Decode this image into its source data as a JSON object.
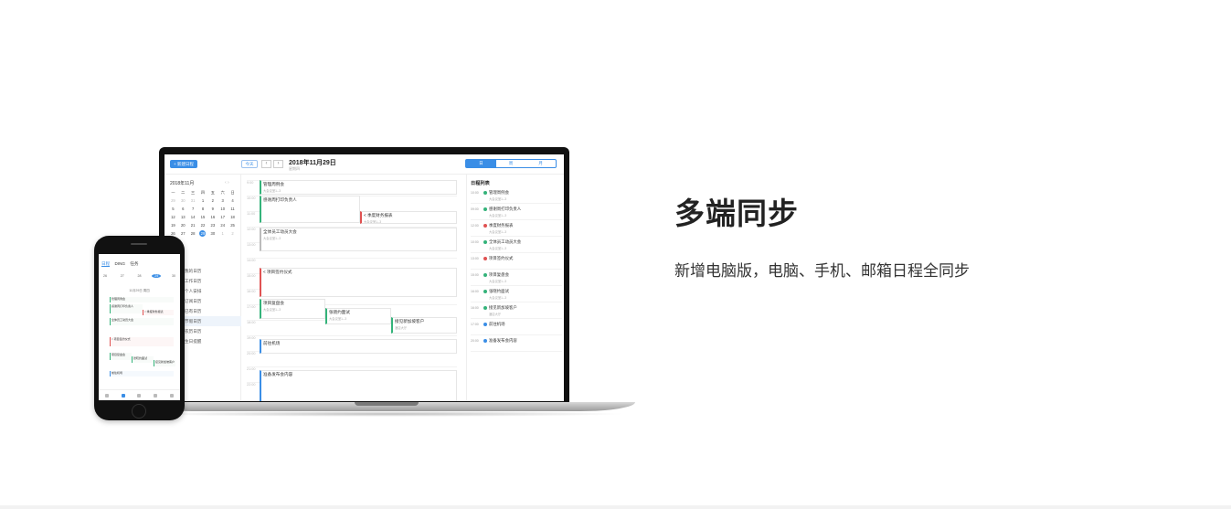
{
  "feature": {
    "title": "多端同步",
    "description": "新增电脑版，电脑、手机、邮箱日程全同步"
  },
  "desktop_app": {
    "new_button": "+ 新建日程",
    "today_button": "今天",
    "prev_icon": "chevron-left-icon",
    "next_icon": "chevron-right-icon",
    "prev_glyph": "‹",
    "next_glyph": "›",
    "date_title": "2018年11月29日",
    "date_subtitle": "星期四",
    "views": [
      "日",
      "周",
      "月"
    ],
    "mini_calendar": {
      "title": "2018年11月",
      "nav_glyphs": "‹  ›",
      "weekdays": [
        "一",
        "二",
        "三",
        "四",
        "五",
        "六",
        "日"
      ],
      "days": [
        "29",
        "30",
        "31",
        "1",
        "2",
        "3",
        "4",
        "5",
        "6",
        "7",
        "8",
        "9",
        "10",
        "11",
        "12",
        "13",
        "14",
        "15",
        "16",
        "17",
        "18",
        "19",
        "20",
        "21",
        "22",
        "23",
        "24",
        "25",
        "26",
        "27",
        "28",
        "29",
        "30",
        "1",
        "2"
      ],
      "today": "29"
    },
    "sidebar_items": [
      "我的日历",
      "工作日历",
      "个人安排",
      "订阅日历",
      "已有日历",
      "节假日历",
      "农历日历",
      "生日提醒"
    ],
    "hours": [
      "9:00",
      "10:00",
      "11:00",
      "12:00",
      "13:00",
      "14:00",
      "15:00",
      "16:00",
      "17:00",
      "18:00",
      "19:00",
      "20:00",
      "21:00",
      "22:00"
    ],
    "events": [
      {
        "title": "管理周例会",
        "sub": "大会议室1--3",
        "style": "green"
      },
      {
        "title": "感谢周打印负责人",
        "sub": "",
        "style": "green"
      },
      {
        "title": "< 季度财务报表",
        "sub": "大会议室1--3",
        "style": "red"
      },
      {
        "title": "全体员工动员大会",
        "sub": "大会议室1--3",
        "style": "gray"
      },
      {
        "title": "< 项目签约仪式",
        "sub": "",
        "style": "red"
      },
      {
        "title": "项目复盘会",
        "sub": "大会议室1--3",
        "style": "green"
      },
      {
        "title": "张晓约面试",
        "sub": "大会议室1--3",
        "style": "green"
      },
      {
        "title": "接见新加坡客户",
        "sub": "酒店大厅",
        "style": "green"
      },
      {
        "title": "前往机场",
        "sub": "",
        "style": "blue"
      },
      {
        "title": "准备发布会内容",
        "sub": "",
        "style": "blue"
      }
    ],
    "agenda": {
      "title": "日程列表",
      "items": [
        {
          "time": "10:00",
          "title": "管理周例会",
          "sub": "大会议室1--3",
          "dot": "green"
        },
        {
          "time": "09:00",
          "title": "感谢周打印负责人",
          "sub": "大会议室1--3",
          "dot": "green"
        },
        {
          "time": "12:00",
          "title": "季度财务报表",
          "sub": "大会议室1--3",
          "dot": "red"
        },
        {
          "time": "10:00",
          "title": "全体员工动员大会",
          "sub": "大会议室1--3",
          "dot": "green"
        },
        {
          "time": "13:00",
          "title": "项目签约仪式",
          "sub": "",
          "dot": "red"
        },
        {
          "time": "15:00",
          "title": "项目复盘会",
          "sub": "大会议室1--3",
          "dot": "green"
        },
        {
          "time": "16:00",
          "title": "张晓约面试",
          "sub": "大会议室1--3",
          "dot": "green"
        },
        {
          "time": "16:00",
          "title": "接见新加坡客户",
          "sub": "酒店大厅",
          "dot": "green"
        },
        {
          "time": "17:00",
          "title": "前往机场",
          "sub": "",
          "dot": "blue"
        },
        {
          "time": "20:00",
          "title": "准备发布会内容",
          "sub": "",
          "dot": "blue"
        }
      ]
    }
  },
  "mobile_app": {
    "tabs": [
      "日程",
      "DING",
      "任务"
    ],
    "week_days": [
      "26",
      "27",
      "28",
      "29",
      "30"
    ],
    "today": "29",
    "date_label": "11月29日 周四",
    "events": [
      {
        "title": "管理周例会",
        "style": "green"
      },
      {
        "title": "感谢周打印负责人",
        "style": "green"
      },
      {
        "title": "< 季度财务报表",
        "style": "red"
      },
      {
        "title": "全体员工动员大会",
        "style": "green"
      },
      {
        "title": "< 项目签约仪式",
        "style": "red"
      },
      {
        "title": "项目复盘会",
        "style": "green"
      },
      {
        "title": "张晓约面试",
        "style": "green"
      },
      {
        "title": "接见新加坡客户",
        "style": "green"
      },
      {
        "title": "前往机场",
        "style": "blue"
      }
    ]
  },
  "colors": {
    "accent": "#3a8ee6",
    "green": "#34b37a",
    "red": "#e05252"
  }
}
